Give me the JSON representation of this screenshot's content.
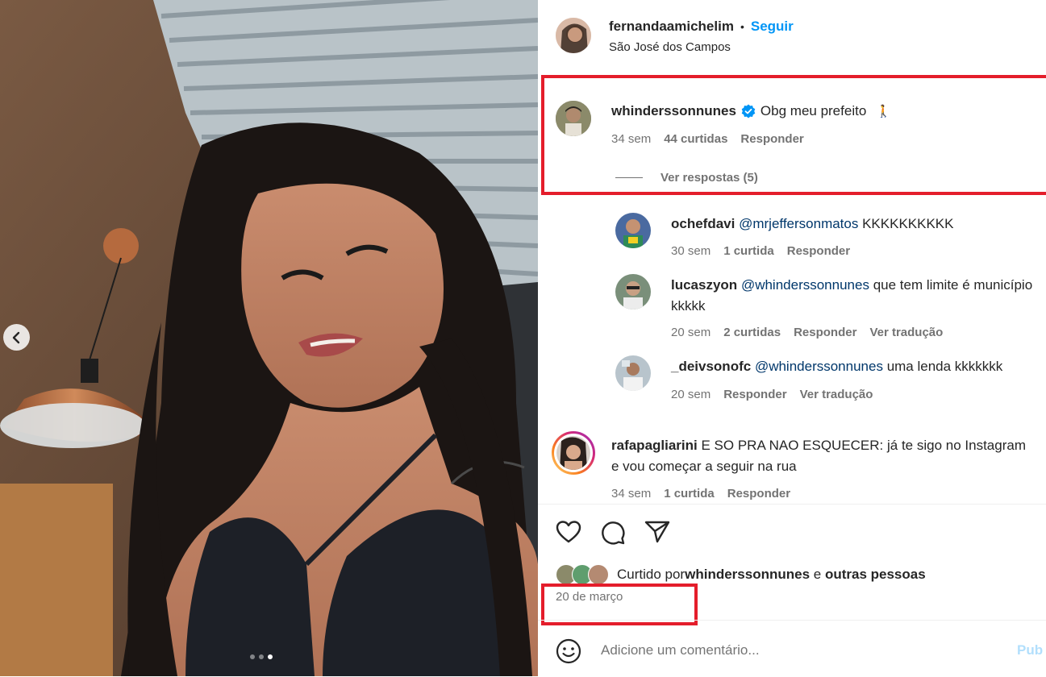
{
  "post": {
    "username": "fernandaamichelim",
    "separator": "•",
    "follow_label": "Seguir",
    "location": "São José dos Campos",
    "carousel_dots": 3,
    "active_dot": 3
  },
  "highlighted_comment": {
    "username": "whinderssonnunes",
    "verified": true,
    "text": "Obg meu prefeito",
    "emoji": "🚶",
    "time": "34 sem",
    "likes": "44 curtidas",
    "reply_label": "Responder",
    "view_replies": "Ver respostas (5)"
  },
  "replies": [
    {
      "username": "ochefdavi",
      "mention": "@mrjeffersonmatos",
      "text": " KKKKKKKKKK",
      "time": "30 sem",
      "likes": "1 curtida",
      "reply_label": "Responder"
    },
    {
      "username": "lucaszyon",
      "mention": "@whinderssonnunes",
      "text": " que tem limite é município kkkkk",
      "time": "20 sem",
      "likes": "2 curtidas",
      "reply_label": "Responder",
      "translate_label": "Ver tradução"
    },
    {
      "username": "_deivsonofc",
      "mention": "@whinderssonnunes",
      "text": " uma lenda kkkkkkk",
      "time": "20 sem",
      "reply_label": "Responder",
      "translate_label": "Ver tradução"
    }
  ],
  "comment_rafa": {
    "username": "rafapagliarini",
    "text": " E SO PRA NAO ESQUECER: já te sigo no Instagram e vou começar a seguir na rua",
    "time": "34 sem",
    "likes": "1 curtida",
    "reply_label": "Responder"
  },
  "likes_summary": {
    "prefix": "Curtido por ",
    "user": "whinderssonnunes",
    "middle": " e ",
    "others": "outras pessoas"
  },
  "date": "20 de março",
  "add_comment": {
    "placeholder": "Adicione um comentário...",
    "publish_label": "Pub"
  },
  "colors": {
    "accent": "#0095f6",
    "highlight_box": "#e41d2b",
    "verified": "#0095f6",
    "muted": "#737373"
  }
}
